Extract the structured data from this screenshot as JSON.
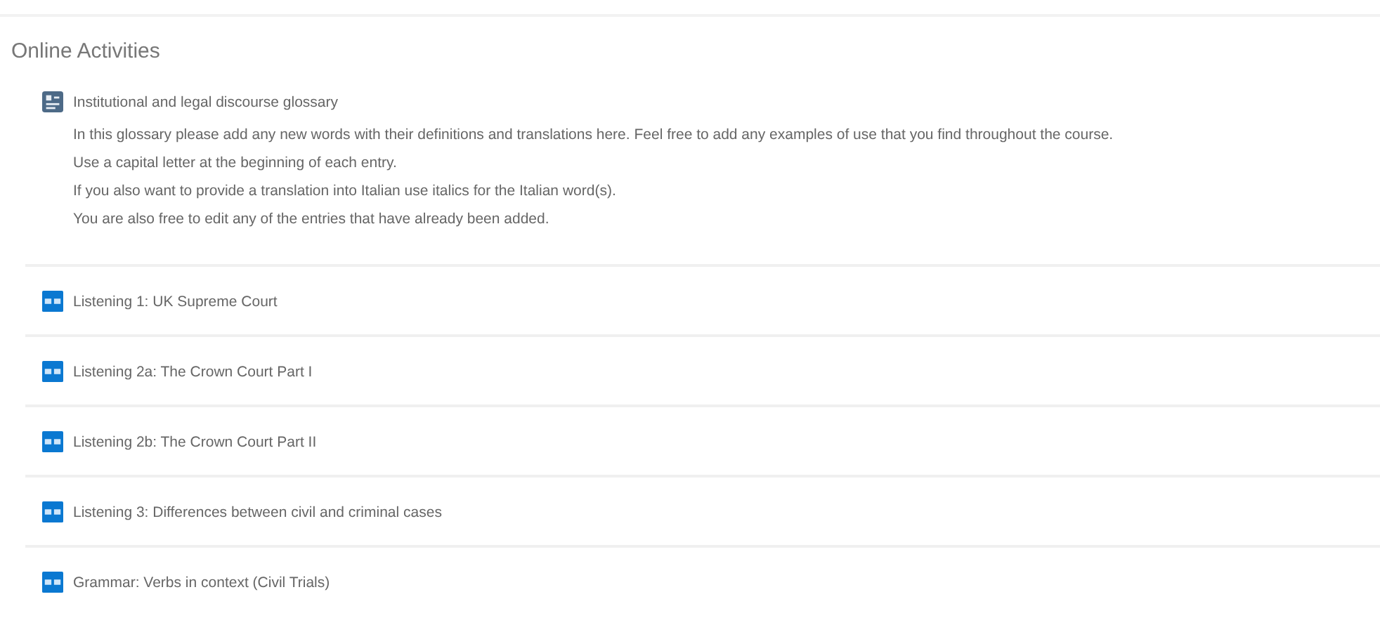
{
  "section": {
    "title": "Online Activities"
  },
  "activities": [
    {
      "kind": "glossary",
      "title": "Institutional and legal discourse glossary",
      "description": [
        "In this glossary please add any new words with their definitions and translations here. Feel free to add any examples of use that you find throughout the course.",
        "Use a capital letter at the beginning of each entry.",
        "If you also want to provide a translation into Italian use italics for the Italian word(s).",
        "You are also free to edit any of the entries that have already been added."
      ]
    },
    {
      "kind": "h5p",
      "title": "Listening 1: UK Supreme Court"
    },
    {
      "kind": "h5p",
      "title": "Listening 2a: The Crown Court Part I"
    },
    {
      "kind": "h5p",
      "title": "Listening 2b: The Crown Court Part II"
    },
    {
      "kind": "h5p",
      "title": "Listening 3: Differences between civil and criminal cases"
    },
    {
      "kind": "h5p",
      "title": "Grammar: Verbs in context (Civil Trials)"
    }
  ]
}
